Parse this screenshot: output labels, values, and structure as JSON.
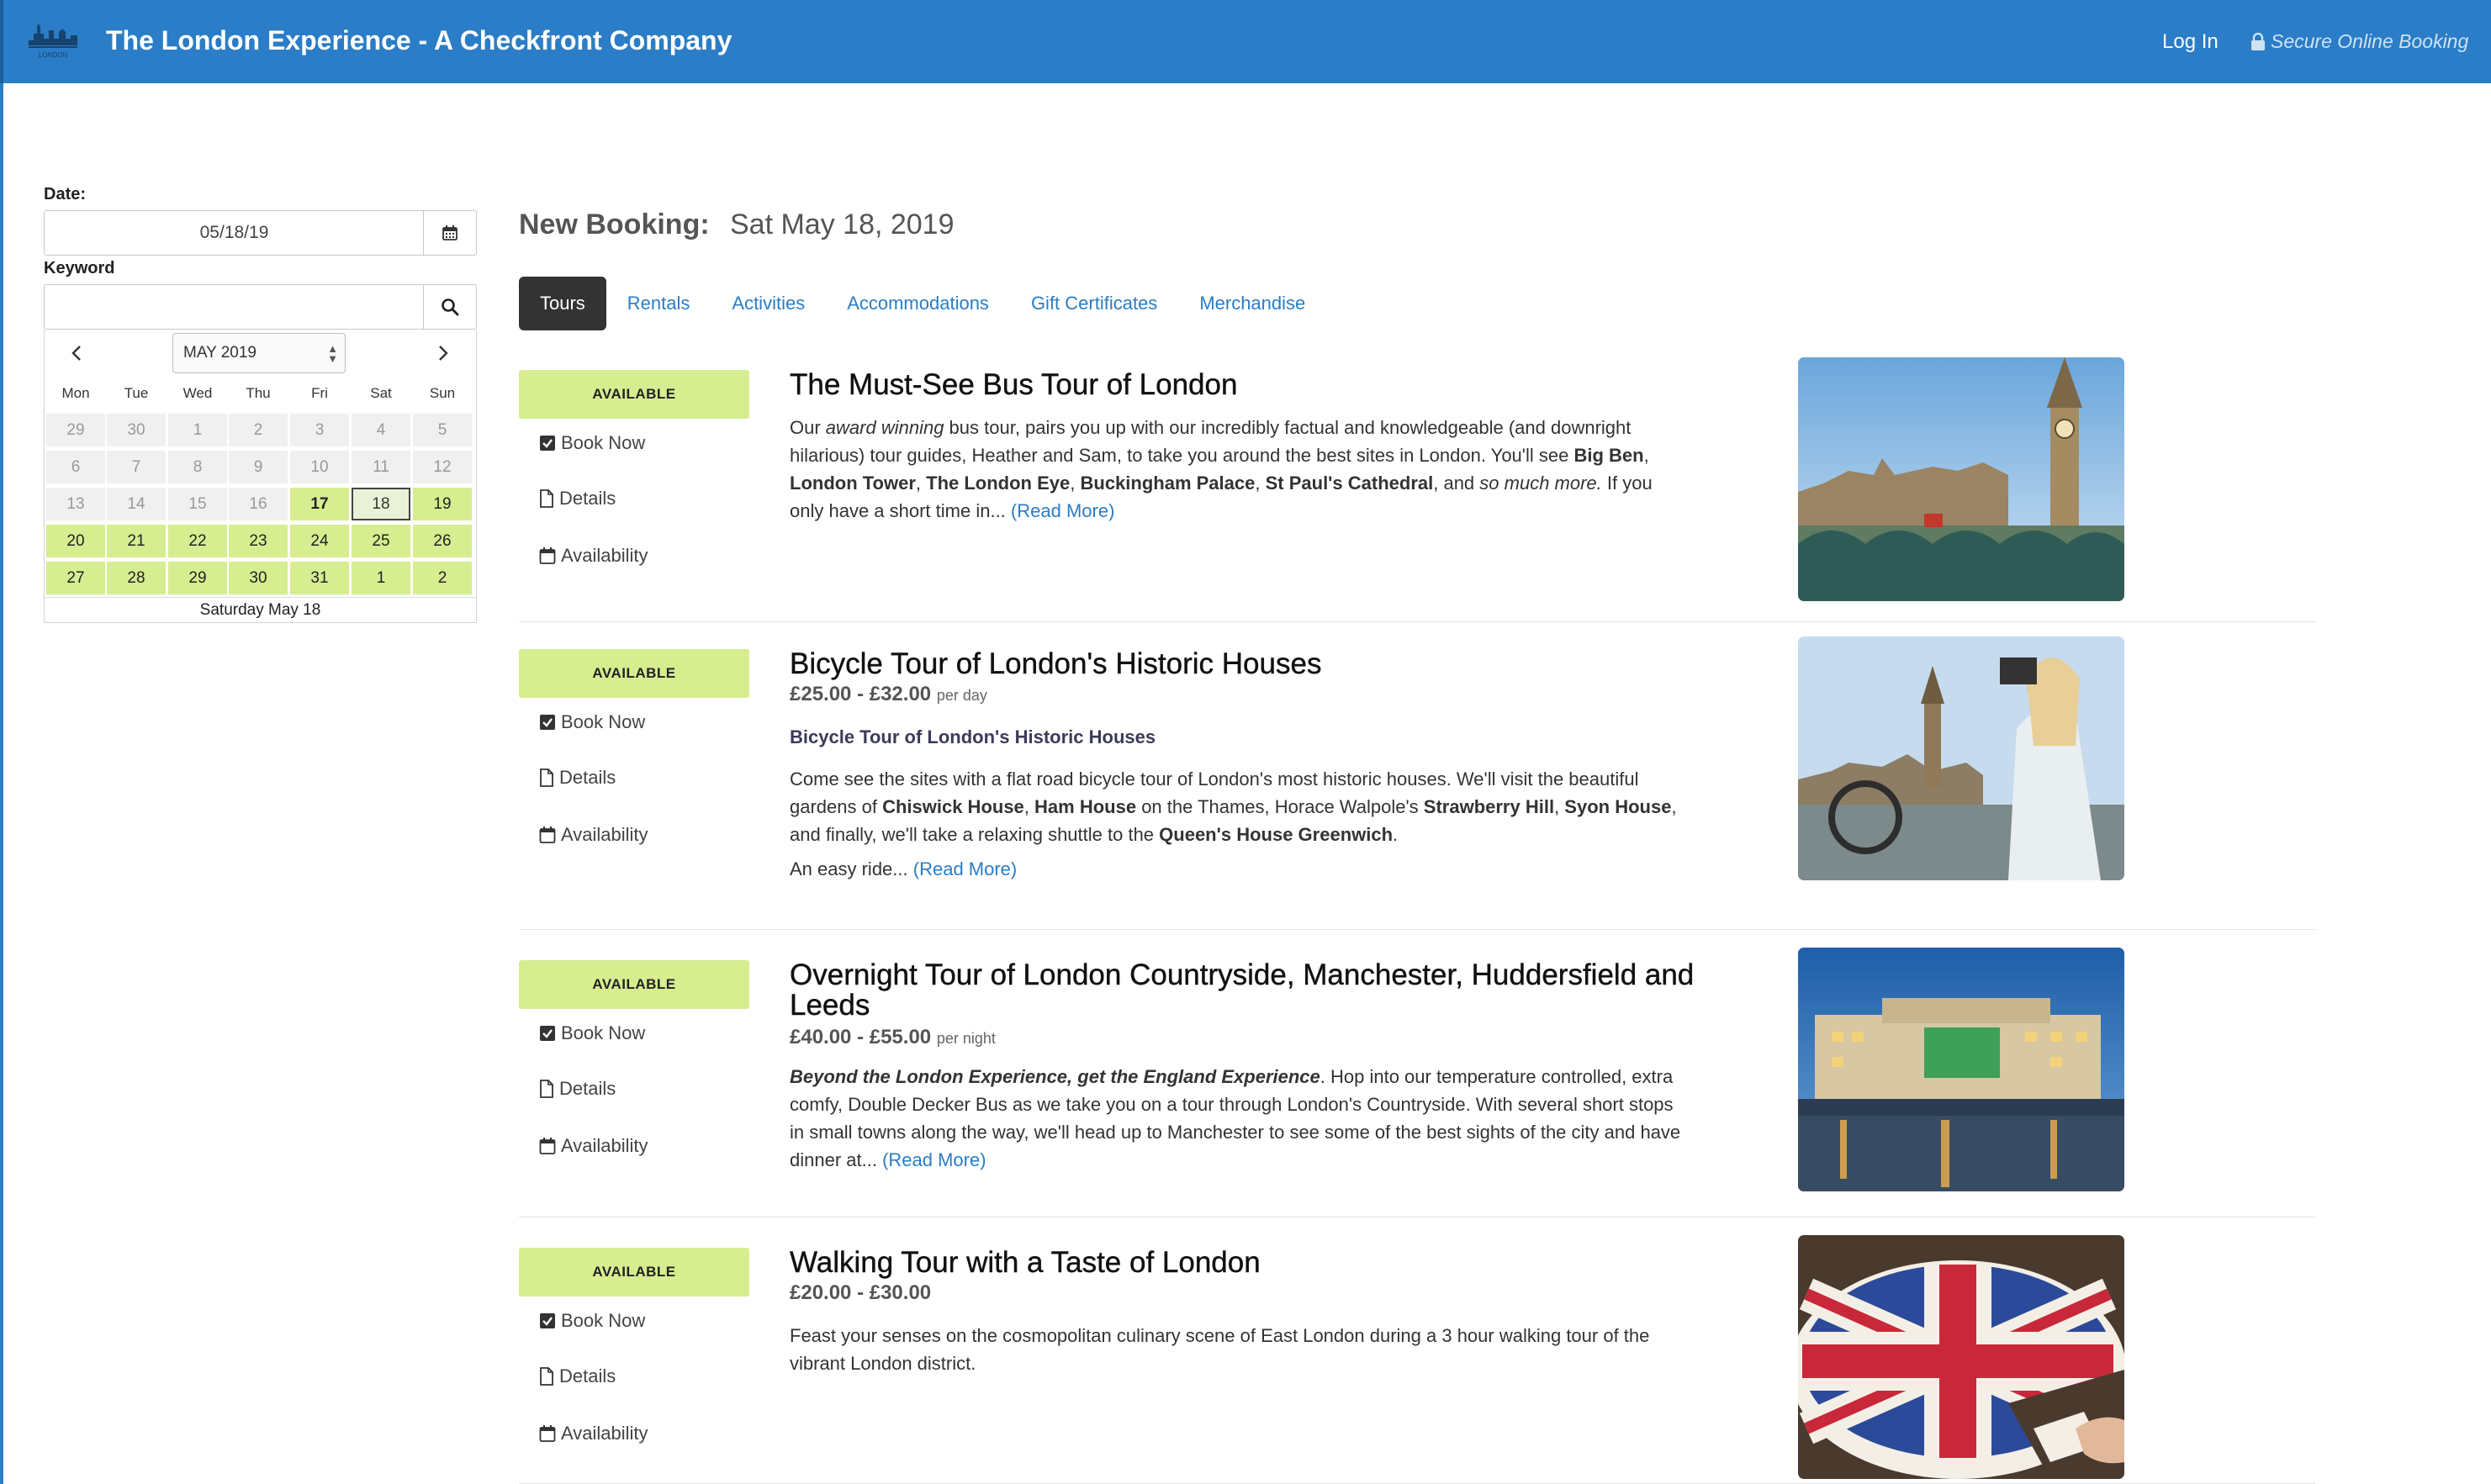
{
  "header": {
    "title": "The London Experience - A Checkfront Company",
    "login": "Log In",
    "secure": "Secure Online Booking",
    "logo_text": "LONDON"
  },
  "sidebar": {
    "date_label": "Date:",
    "date_value": "05/18/19",
    "keyword_label": "Keyword",
    "keyword_value": "",
    "calendar": {
      "month": "MAY 2019",
      "weekdays": [
        "Mon",
        "Tue",
        "Wed",
        "Thu",
        "Fri",
        "Sat",
        "Sun"
      ],
      "weeks": [
        [
          {
            "d": "29",
            "s": "past"
          },
          {
            "d": "30",
            "s": "past"
          },
          {
            "d": "1",
            "s": "past"
          },
          {
            "d": "2",
            "s": "past"
          },
          {
            "d": "3",
            "s": "past"
          },
          {
            "d": "4",
            "s": "past"
          },
          {
            "d": "5",
            "s": "past"
          }
        ],
        [
          {
            "d": "6",
            "s": "past"
          },
          {
            "d": "7",
            "s": "past"
          },
          {
            "d": "8",
            "s": "past"
          },
          {
            "d": "9",
            "s": "past"
          },
          {
            "d": "10",
            "s": "past"
          },
          {
            "d": "11",
            "s": "past"
          },
          {
            "d": "12",
            "s": "past"
          }
        ],
        [
          {
            "d": "13",
            "s": "past"
          },
          {
            "d": "14",
            "s": "past"
          },
          {
            "d": "15",
            "s": "past"
          },
          {
            "d": "16",
            "s": "past"
          },
          {
            "d": "17",
            "s": "today"
          },
          {
            "d": "18",
            "s": "selected"
          },
          {
            "d": "19",
            "s": "avail"
          }
        ],
        [
          {
            "d": "20",
            "s": "avail"
          },
          {
            "d": "21",
            "s": "avail"
          },
          {
            "d": "22",
            "s": "avail"
          },
          {
            "d": "23",
            "s": "avail"
          },
          {
            "d": "24",
            "s": "avail"
          },
          {
            "d": "25",
            "s": "avail"
          },
          {
            "d": "26",
            "s": "avail"
          }
        ],
        [
          {
            "d": "27",
            "s": "avail"
          },
          {
            "d": "28",
            "s": "avail"
          },
          {
            "d": "29",
            "s": "avail"
          },
          {
            "d": "30",
            "s": "avail"
          },
          {
            "d": "31",
            "s": "avail"
          },
          {
            "d": "1",
            "s": "avail"
          },
          {
            "d": "2",
            "s": "avail"
          }
        ]
      ],
      "footer": "Saturday May 18"
    }
  },
  "main": {
    "heading_label": "New Booking:",
    "heading_date": "Sat May 18, 2019",
    "tabs": [
      "Tours",
      "Rentals",
      "Activities",
      "Accommodations",
      "Gift Certificates",
      "Merchandise"
    ],
    "active_tab": "Tours",
    "actions": {
      "available": "AVAILABLE",
      "book_now": "Book Now",
      "details": "Details",
      "availability": "Availability"
    },
    "items": [
      {
        "title": "The Must-See Bus Tour of London",
        "price": "",
        "price_unit": "",
        "subtitle": "",
        "description_html": "Our <i>award winning</i> bus tour, pairs you up with our incredibly factual and knowledgeable (and downright hilarious) tour guides, Heather and Sam, to take you around the best sites in London. You'll see <b>Big Ben</b>, <b>London Tower</b>, <b>The London Eye</b>, <b>Buckingham Palace</b>, <b>St Paul's Cathedral</b>, and <i>so much more.</i> If you only have a short time in...",
        "description_extra_html": "",
        "read_more": "(Read More)",
        "image": "big-ben-westminster-bridge"
      },
      {
        "title": "Bicycle Tour of London's Historic Houses",
        "price": "£25.00 - £32.00",
        "price_unit": "per day",
        "subtitle": "Bicycle Tour of London's Historic Houses",
        "description_html": "Come see the sites with a flat road bicycle tour of London's most historic houses. We'll visit the beautiful gardens of <b>Chiswick House</b>, <b>Ham House</b> on the Thames, Horace Walpole's <b>Strawberry Hill</b>, <b>Syon House</b>, and finally, we'll take a relaxing shuttle to the <b>Queen's House Greenwich</b>.",
        "description_extra_html": "An easy ride...",
        "read_more": "(Read More)",
        "image": "cyclist-photographing-big-ben"
      },
      {
        "title": "Overnight Tour of London Countryside, Manchester, Huddersfield and Leeds",
        "price": "£40.00 - £55.00",
        "price_unit": "per night",
        "subtitle": "",
        "description_html": "<b><i>Beyond the London Experience, get the England Experience</i></b>. Hop into our temperature controlled, extra comfy, Double Decker Bus as we take you on a tour through London's Countryside. With several short stops in small towns along the way, we'll head up to Manchester to see some of the best sights of the city and have dinner at...",
        "description_extra_html": "",
        "read_more": "(Read More)",
        "image": "manchester-square-night"
      },
      {
        "title": "Walking Tour with a Taste of London",
        "price": "£20.00 - £30.00",
        "price_unit": "",
        "subtitle": "",
        "description_html": "Feast your senses on the cosmopolitan culinary scene of East London during a 3 hour walking tour of the vibrant London district.",
        "description_extra_html": "",
        "read_more": "",
        "image": "union-jack-cake"
      }
    ]
  },
  "colors": {
    "header_blue": "#2a7dc6",
    "available_green": "#d6ed90",
    "active_tab": "#333333",
    "link": "#2a7dc6"
  }
}
